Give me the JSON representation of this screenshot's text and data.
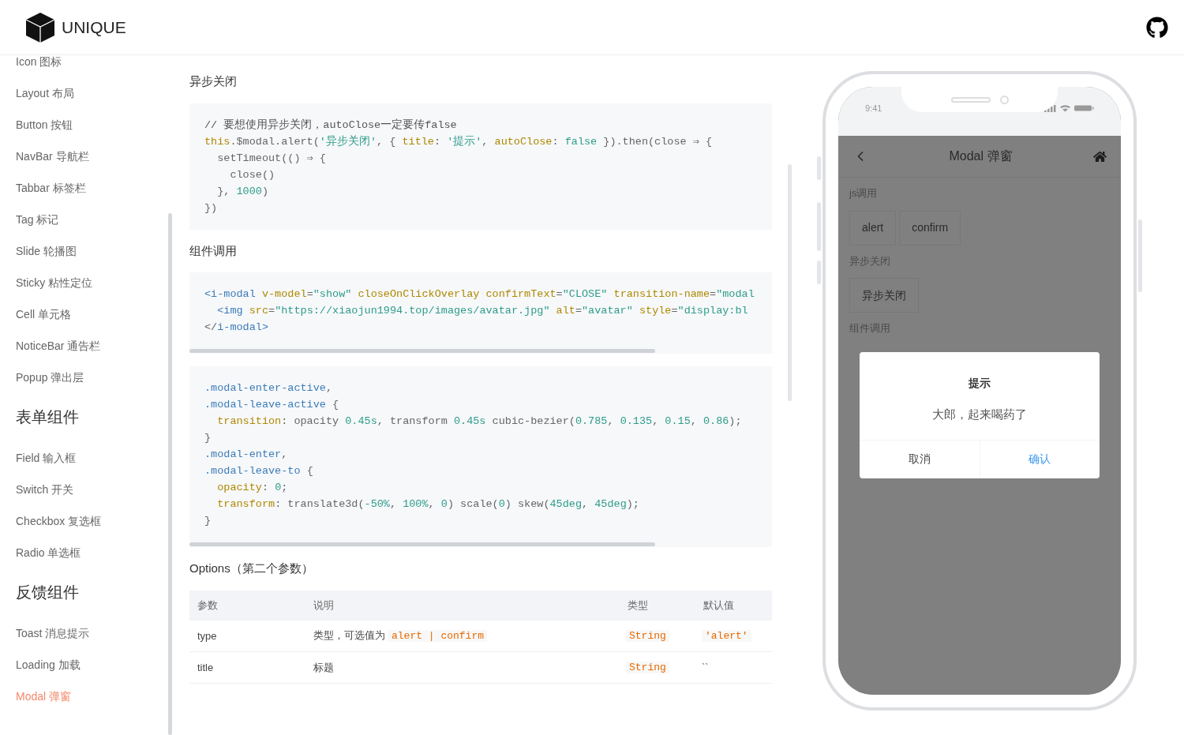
{
  "header": {
    "logo_text": "UNIQUE"
  },
  "sidebar": [
    {
      "kind": "item",
      "label": "Icon 图标",
      "selected": false
    },
    {
      "kind": "item",
      "label": "Layout 布局",
      "selected": false
    },
    {
      "kind": "item",
      "label": "Button 按钮",
      "selected": false
    },
    {
      "kind": "item",
      "label": "NavBar 导航栏",
      "selected": false
    },
    {
      "kind": "item",
      "label": "Tabbar 标签栏",
      "selected": false
    },
    {
      "kind": "item",
      "label": "Tag 标记",
      "selected": false
    },
    {
      "kind": "item",
      "label": "Slide 轮播图",
      "selected": false
    },
    {
      "kind": "item",
      "label": "Sticky 粘性定位",
      "selected": false
    },
    {
      "kind": "item",
      "label": "Cell 单元格",
      "selected": false
    },
    {
      "kind": "item",
      "label": "NoticeBar 通告栏",
      "selected": false
    },
    {
      "kind": "item",
      "label": "Popup 弹出层",
      "selected": false
    },
    {
      "kind": "group",
      "label": "表单组件"
    },
    {
      "kind": "item",
      "label": "Field 输入框",
      "selected": false
    },
    {
      "kind": "item",
      "label": "Switch 开关",
      "selected": false
    },
    {
      "kind": "item",
      "label": "Checkbox 复选框",
      "selected": false
    },
    {
      "kind": "item",
      "label": "Radio 单选框",
      "selected": false
    },
    {
      "kind": "group",
      "label": "反馈组件"
    },
    {
      "kind": "item",
      "label": "Toast 消息提示",
      "selected": false
    },
    {
      "kind": "item",
      "label": "Loading 加载",
      "selected": false
    },
    {
      "kind": "item",
      "label": "Modal 弹窗",
      "selected": true
    }
  ],
  "content": [
    {
      "kind": "heading",
      "text": "异步关闭"
    },
    {
      "kind": "code",
      "scrollbar": false,
      "lines": [
        [
          {
            "text": "// 要想使用异步关闭，autoClose一定要传false",
            "kind": "comment"
          }
        ],
        [
          {
            "text": "this",
            "kind": "key"
          },
          {
            "text": ".$modal.alert(",
            "kind": "plain"
          },
          {
            "text": "'异步关闭'",
            "kind": "string"
          },
          {
            "text": ", { ",
            "kind": "plain"
          },
          {
            "text": "title",
            "kind": "key"
          },
          {
            "text": ": ",
            "kind": "plain"
          },
          {
            "text": "'提示'",
            "kind": "string"
          },
          {
            "text": ", ",
            "kind": "plain"
          },
          {
            "text": "autoClose",
            "kind": "key"
          },
          {
            "text": ": ",
            "kind": "plain"
          },
          {
            "text": "false",
            "kind": "string"
          },
          {
            "text": " }).then(close ⇒ {",
            "kind": "plain"
          }
        ],
        [
          {
            "text": "  setTimeout(() ⇒ {",
            "kind": "plain"
          }
        ],
        [
          {
            "text": "    close()",
            "kind": "plain"
          }
        ],
        [
          {
            "text": "  }, ",
            "kind": "plain"
          },
          {
            "text": "1000",
            "kind": "string"
          },
          {
            "text": ")",
            "kind": "plain"
          }
        ],
        [
          {
            "text": "})",
            "kind": "plain"
          }
        ]
      ]
    },
    {
      "kind": "heading",
      "text": "组件调用"
    },
    {
      "kind": "code",
      "scrollbar": true,
      "lines": [
        [
          {
            "text": "<i-modal ",
            "kind": "tag"
          },
          {
            "text": "v-model",
            "kind": "key"
          },
          {
            "text": "=",
            "kind": "plain"
          },
          {
            "text": "\"show\"",
            "kind": "string"
          },
          {
            "text": " closeOnClickOverlay confirmText",
            "kind": "key"
          },
          {
            "text": "=",
            "kind": "plain"
          },
          {
            "text": "\"CLOSE\"",
            "kind": "string"
          },
          {
            "text": " transition-name",
            "kind": "key"
          },
          {
            "text": "=",
            "kind": "plain"
          },
          {
            "text": "\"modal",
            "kind": "string"
          }
        ],
        [
          {
            "text": "  <img ",
            "kind": "tag"
          },
          {
            "text": "src",
            "kind": "key"
          },
          {
            "text": "=",
            "kind": "plain"
          },
          {
            "text": "\"https://xiaojun1994.top/images/avatar.jpg\"",
            "kind": "string"
          },
          {
            "text": " alt",
            "kind": "key"
          },
          {
            "text": "=",
            "kind": "plain"
          },
          {
            "text": "\"avatar\"",
            "kind": "string"
          },
          {
            "text": " style",
            "kind": "key"
          },
          {
            "text": "=",
            "kind": "plain"
          },
          {
            "text": "\"display:bl",
            "kind": "string"
          }
        ],
        [
          {
            "text": "</",
            "kind": "plain"
          },
          {
            "text": "i-modal>",
            "kind": "tag"
          }
        ]
      ]
    },
    {
      "kind": "code",
      "scrollbar": true,
      "lines": [
        [
          {
            "text": ".modal-enter-active",
            "kind": "tag"
          },
          {
            "text": ",",
            "kind": "plain"
          }
        ],
        [
          {
            "text": ".modal-leave-active",
            "kind": "tag"
          },
          {
            "text": " {",
            "kind": "plain"
          }
        ],
        [
          {
            "text": "  transition",
            "kind": "key"
          },
          {
            "text": ": opacity ",
            "kind": "plain"
          },
          {
            "text": "0.45s",
            "kind": "string"
          },
          {
            "text": ", transform ",
            "kind": "plain"
          },
          {
            "text": "0.45s",
            "kind": "string"
          },
          {
            "text": " cubic-bezier(",
            "kind": "plain"
          },
          {
            "text": "0.785",
            "kind": "string"
          },
          {
            "text": ", ",
            "kind": "plain"
          },
          {
            "text": "0.135",
            "kind": "string"
          },
          {
            "text": ", ",
            "kind": "plain"
          },
          {
            "text": "0.15",
            "kind": "string"
          },
          {
            "text": ", ",
            "kind": "plain"
          },
          {
            "text": "0.86",
            "kind": "string"
          },
          {
            "text": ");",
            "kind": "plain"
          }
        ],
        [
          {
            "text": "}",
            "kind": "plain"
          }
        ],
        [
          {
            "text": ".modal-enter",
            "kind": "tag"
          },
          {
            "text": ",",
            "kind": "plain"
          }
        ],
        [
          {
            "text": ".modal-leave-to",
            "kind": "tag"
          },
          {
            "text": " {",
            "kind": "plain"
          }
        ],
        [
          {
            "text": "  opacity",
            "kind": "key"
          },
          {
            "text": ": ",
            "kind": "plain"
          },
          {
            "text": "0",
            "kind": "string"
          },
          {
            "text": ";",
            "kind": "plain"
          }
        ],
        [
          {
            "text": "  transform",
            "kind": "key"
          },
          {
            "text": ": translate3d(",
            "kind": "plain"
          },
          {
            "text": "-50%",
            "kind": "string"
          },
          {
            "text": ", ",
            "kind": "plain"
          },
          {
            "text": "100%",
            "kind": "string"
          },
          {
            "text": ", ",
            "kind": "plain"
          },
          {
            "text": "0",
            "kind": "string"
          },
          {
            "text": ") scale(",
            "kind": "plain"
          },
          {
            "text": "0",
            "kind": "string"
          },
          {
            "text": ") skew(",
            "kind": "plain"
          },
          {
            "text": "45deg",
            "kind": "string"
          },
          {
            "text": ", ",
            "kind": "plain"
          },
          {
            "text": "45deg",
            "kind": "string"
          },
          {
            "text": ");",
            "kind": "plain"
          }
        ],
        [
          {
            "text": "}",
            "kind": "plain"
          }
        ]
      ]
    },
    {
      "kind": "heading",
      "text": "Options（第二个参数）"
    }
  ],
  "table": {
    "columns": [
      "参数",
      "说明",
      "类型",
      "默认值"
    ],
    "rows": [
      {
        "param": "type",
        "description": "类型，可选值为",
        "description_code": "alert | confirm",
        "type": "String",
        "default": {
          "kind": "code",
          "text": "'alert'"
        }
      },
      {
        "param": "title",
        "description": "标题",
        "type": "String",
        "default": {
          "kind": "text",
          "text": "``"
        }
      }
    ]
  },
  "phone": {
    "time": "9:41",
    "nav_title": "Modal 弹窗",
    "sections": [
      {
        "title": "js调用",
        "buttons": [
          "alert",
          "confirm"
        ]
      },
      {
        "title": "异步关闭",
        "buttons": [
          "异步关闭"
        ]
      },
      {
        "title": "组件调用"
      }
    ],
    "modal": {
      "title": "提示",
      "message": "大郎，起来喝药了",
      "cancel": "取消",
      "confirm": "确认"
    }
  }
}
